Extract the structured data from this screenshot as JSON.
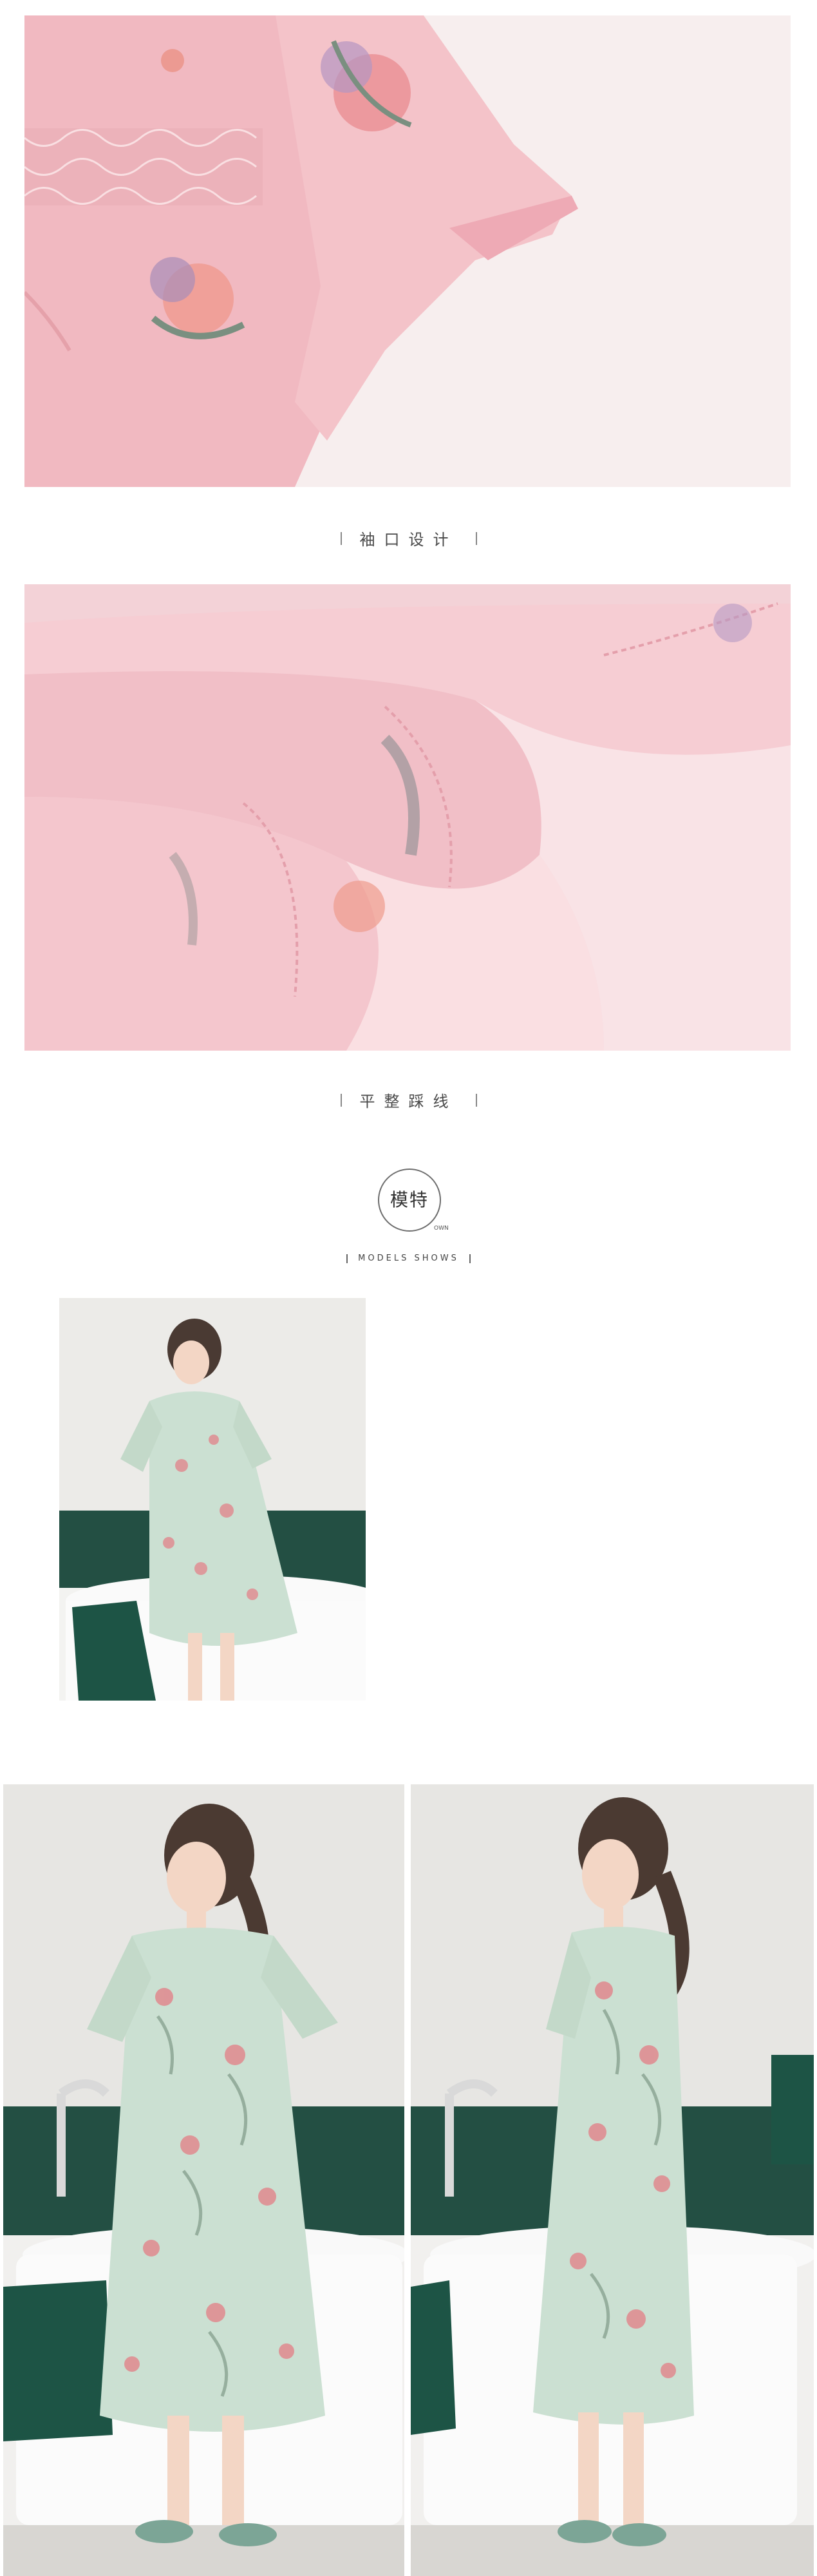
{
  "sections": {
    "sleeve_caption": "袖口设计",
    "stitch_caption": "平整踩线",
    "models": {
      "title": "模特",
      "tag": "OWN",
      "subtitle": "MODELS SHOWS"
    }
  },
  "colors": {
    "fabric_pink": "#f3c3c9",
    "fabric_mint": "#c9ded0",
    "bath_green": "#1f4d40",
    "wall_grey": "#e6e4e1"
  },
  "photos": [
    {
      "subject": "pink floral nightdress sleeve with lace trim"
    },
    {
      "subject": "pink hem with zigzag stitching"
    },
    {
      "subject": "model in mint floral nightdress, bathroom"
    },
    {
      "subject": "model front view, mint floral nightdress"
    },
    {
      "subject": "model side view, mint floral nightdress"
    }
  ]
}
